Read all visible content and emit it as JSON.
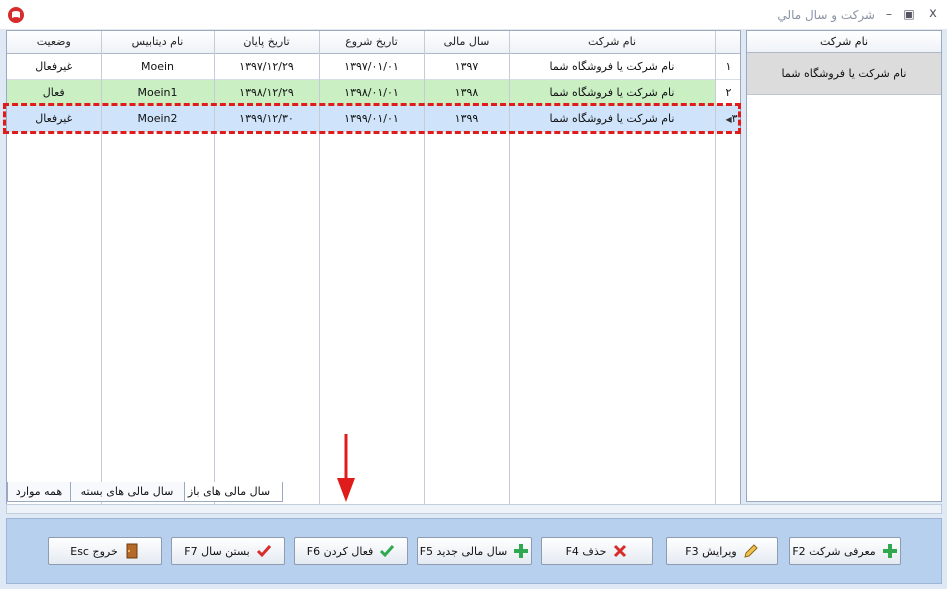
{
  "window": {
    "title": "شركت و سال مالي",
    "close_glyph": "x",
    "max_glyph": "▣",
    "min_glyph": "–"
  },
  "grid": {
    "columns": [
      "وضعیت",
      "نام دیتابیس",
      "تاریخ پایان",
      "تاریخ شروع",
      "سال مالی",
      "نام شرکت"
    ],
    "rows": [
      {
        "num": "۱",
        "status": "غیرفعال",
        "db": "Moein",
        "end": "۱۳۹۷/۱۲/۲۹",
        "start": "۱۳۹۷/۰۱/۰۱",
        "year": "۱۳۹۷",
        "company": "نام شرکت یا فروشگاه شما"
      },
      {
        "num": "۲",
        "status": "فعال",
        "db": "Moein1",
        "end": "۱۳۹۸/۱۲/۲۹",
        "start": "۱۳۹۸/۰۱/۰۱",
        "year": "۱۳۹۸",
        "company": "نام شرکت یا فروشگاه شما"
      },
      {
        "num": "۳",
        "status": "غیرفعال",
        "db": "Moein2",
        "end": "۱۳۹۹/۱۲/۳۰",
        "start": "۱۳۹۹/۰۱/۰۱",
        "year": "۱۳۹۹",
        "company": "نام شرکت یا فروشگاه شما"
      }
    ]
  },
  "tabs": {
    "open_years": "سال مالی های باز",
    "closed_years": "سال مالی های بسته",
    "all": "همه موارد"
  },
  "right_panel": {
    "header": "نام شرکت",
    "item": "نام شرکت یا فروشگاه شما"
  },
  "buttons": {
    "new_company": "معرفی شرکت F2",
    "edit": "ویرایش F3",
    "delete": "حذف F4",
    "new_year": "سال مالی جدید F5",
    "activate": "فعال کردن F6",
    "close_year": "بستن سال F7",
    "exit": "خروج Esc"
  },
  "colors": {
    "active_row": "#c9efc3",
    "selected_row": "#cfe4fb",
    "highlight": "#e01b1b",
    "accent_green": "#2fa84f",
    "accent_red": "#d72c2c"
  }
}
